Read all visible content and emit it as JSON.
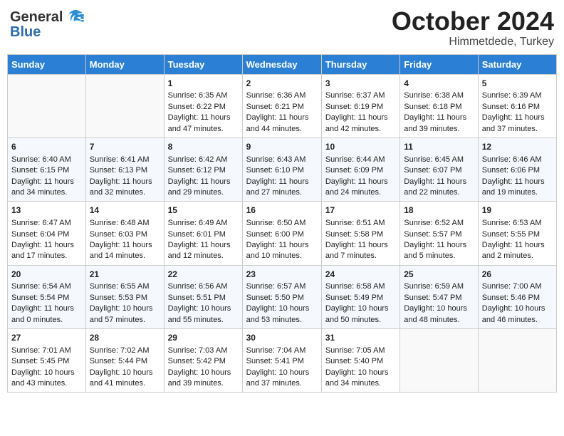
{
  "header": {
    "logo_general": "General",
    "logo_blue": "Blue",
    "month": "October 2024",
    "location": "Himmetdede, Turkey"
  },
  "days_of_week": [
    "Sunday",
    "Monday",
    "Tuesday",
    "Wednesday",
    "Thursday",
    "Friday",
    "Saturday"
  ],
  "weeks": [
    [
      {
        "day": "",
        "info": ""
      },
      {
        "day": "",
        "info": ""
      },
      {
        "day": "1",
        "info": "Sunrise: 6:35 AM\nSunset: 6:22 PM\nDaylight: 11 hours and 47 minutes."
      },
      {
        "day": "2",
        "info": "Sunrise: 6:36 AM\nSunset: 6:21 PM\nDaylight: 11 hours and 44 minutes."
      },
      {
        "day": "3",
        "info": "Sunrise: 6:37 AM\nSunset: 6:19 PM\nDaylight: 11 hours and 42 minutes."
      },
      {
        "day": "4",
        "info": "Sunrise: 6:38 AM\nSunset: 6:18 PM\nDaylight: 11 hours and 39 minutes."
      },
      {
        "day": "5",
        "info": "Sunrise: 6:39 AM\nSunset: 6:16 PM\nDaylight: 11 hours and 37 minutes."
      }
    ],
    [
      {
        "day": "6",
        "info": "Sunrise: 6:40 AM\nSunset: 6:15 PM\nDaylight: 11 hours and 34 minutes."
      },
      {
        "day": "7",
        "info": "Sunrise: 6:41 AM\nSunset: 6:13 PM\nDaylight: 11 hours and 32 minutes."
      },
      {
        "day": "8",
        "info": "Sunrise: 6:42 AM\nSunset: 6:12 PM\nDaylight: 11 hours and 29 minutes."
      },
      {
        "day": "9",
        "info": "Sunrise: 6:43 AM\nSunset: 6:10 PM\nDaylight: 11 hours and 27 minutes."
      },
      {
        "day": "10",
        "info": "Sunrise: 6:44 AM\nSunset: 6:09 PM\nDaylight: 11 hours and 24 minutes."
      },
      {
        "day": "11",
        "info": "Sunrise: 6:45 AM\nSunset: 6:07 PM\nDaylight: 11 hours and 22 minutes."
      },
      {
        "day": "12",
        "info": "Sunrise: 6:46 AM\nSunset: 6:06 PM\nDaylight: 11 hours and 19 minutes."
      }
    ],
    [
      {
        "day": "13",
        "info": "Sunrise: 6:47 AM\nSunset: 6:04 PM\nDaylight: 11 hours and 17 minutes."
      },
      {
        "day": "14",
        "info": "Sunrise: 6:48 AM\nSunset: 6:03 PM\nDaylight: 11 hours and 14 minutes."
      },
      {
        "day": "15",
        "info": "Sunrise: 6:49 AM\nSunset: 6:01 PM\nDaylight: 11 hours and 12 minutes."
      },
      {
        "day": "16",
        "info": "Sunrise: 6:50 AM\nSunset: 6:00 PM\nDaylight: 11 hours and 10 minutes."
      },
      {
        "day": "17",
        "info": "Sunrise: 6:51 AM\nSunset: 5:58 PM\nDaylight: 11 hours and 7 minutes."
      },
      {
        "day": "18",
        "info": "Sunrise: 6:52 AM\nSunset: 5:57 PM\nDaylight: 11 hours and 5 minutes."
      },
      {
        "day": "19",
        "info": "Sunrise: 6:53 AM\nSunset: 5:55 PM\nDaylight: 11 hours and 2 minutes."
      }
    ],
    [
      {
        "day": "20",
        "info": "Sunrise: 6:54 AM\nSunset: 5:54 PM\nDaylight: 11 hours and 0 minutes."
      },
      {
        "day": "21",
        "info": "Sunrise: 6:55 AM\nSunset: 5:53 PM\nDaylight: 10 hours and 57 minutes."
      },
      {
        "day": "22",
        "info": "Sunrise: 6:56 AM\nSunset: 5:51 PM\nDaylight: 10 hours and 55 minutes."
      },
      {
        "day": "23",
        "info": "Sunrise: 6:57 AM\nSunset: 5:50 PM\nDaylight: 10 hours and 53 minutes."
      },
      {
        "day": "24",
        "info": "Sunrise: 6:58 AM\nSunset: 5:49 PM\nDaylight: 10 hours and 50 minutes."
      },
      {
        "day": "25",
        "info": "Sunrise: 6:59 AM\nSunset: 5:47 PM\nDaylight: 10 hours and 48 minutes."
      },
      {
        "day": "26",
        "info": "Sunrise: 7:00 AM\nSunset: 5:46 PM\nDaylight: 10 hours and 46 minutes."
      }
    ],
    [
      {
        "day": "27",
        "info": "Sunrise: 7:01 AM\nSunset: 5:45 PM\nDaylight: 10 hours and 43 minutes."
      },
      {
        "day": "28",
        "info": "Sunrise: 7:02 AM\nSunset: 5:44 PM\nDaylight: 10 hours and 41 minutes."
      },
      {
        "day": "29",
        "info": "Sunrise: 7:03 AM\nSunset: 5:42 PM\nDaylight: 10 hours and 39 minutes."
      },
      {
        "day": "30",
        "info": "Sunrise: 7:04 AM\nSunset: 5:41 PM\nDaylight: 10 hours and 37 minutes."
      },
      {
        "day": "31",
        "info": "Sunrise: 7:05 AM\nSunset: 5:40 PM\nDaylight: 10 hours and 34 minutes."
      },
      {
        "day": "",
        "info": ""
      },
      {
        "day": "",
        "info": ""
      }
    ]
  ]
}
